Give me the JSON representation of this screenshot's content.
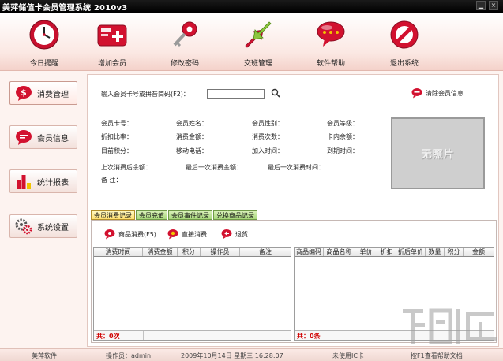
{
  "window": {
    "title": "美萍储值卡会员管理系统 2010v3"
  },
  "title_controls": {
    "close": "×"
  },
  "toolbar": [
    {
      "label": "今日提醒",
      "icon": "clock-icon"
    },
    {
      "label": "增加会员",
      "icon": "add-member-icon"
    },
    {
      "label": "修改密码",
      "icon": "key-icon"
    },
    {
      "label": "交班管理",
      "icon": "exchange-arrows-icon"
    },
    {
      "label": "软件帮助",
      "icon": "help-bubble-icon"
    },
    {
      "label": "退出系统",
      "icon": "no-entry-icon"
    }
  ],
  "sidebar": [
    {
      "label": "消费管理",
      "icon": "dollar-icon",
      "active": true
    },
    {
      "label": "会员信息",
      "icon": "chat-bubble-icon",
      "active": false
    },
    {
      "label": "统计报表",
      "icon": "bar-chart-icon",
      "active": false
    },
    {
      "label": "系统设置",
      "icon": "gears-icon",
      "active": false
    }
  ],
  "search": {
    "label": "输入会员卡号或拼音简码(F2)：",
    "value": ""
  },
  "clear_button": "清除会员信息",
  "fields": {
    "card_no": "会员卡号：",
    "name": "会员姓名：",
    "gender": "会员性别：",
    "level": "会员等级：",
    "discount": "折扣比率：",
    "spent": "消费金额：",
    "times": "消费次数：",
    "balance": "卡内余额：",
    "points": "目前积分：",
    "mobile": "移动电话：",
    "join_date": "加入时间：",
    "expire": "到期时间：",
    "last_balance": "上次消费后余额：",
    "last_amount": "最后一次消费金额：",
    "last_time": "最后一次消费时间：",
    "note": "备    注："
  },
  "photo_text": "无照片",
  "tabs": [
    {
      "label": "会员消费记录",
      "active": true
    },
    {
      "label": "会员充值",
      "active": false
    },
    {
      "label": "会员事件记录",
      "active": false
    },
    {
      "label": "兑换商品记录",
      "active": false
    }
  ],
  "actions": [
    {
      "label": "商品消费(F5)",
      "icon": "cart-bubble-icon"
    },
    {
      "label": "直接消费",
      "icon": "coin-bubble-icon"
    },
    {
      "label": "退货",
      "icon": "return-bubble-icon"
    }
  ],
  "left_table": {
    "columns": [
      "消费时间",
      "消费金额",
      "积分",
      "操作员",
      "备注"
    ],
    "footer": "共：0次"
  },
  "right_table": {
    "columns": [
      "商品编码",
      "商品名称",
      "单价",
      "折扣",
      "折后单价",
      "数量",
      "积分",
      "金额"
    ],
    "footer": "共：0条"
  },
  "statusbar": {
    "company": "美萍软件",
    "operator": "操作员：admin",
    "datetime": "2009年10月14日  星期三  16:28:07",
    "ic_card": "未使用IC卡",
    "help": "按F1查看帮助文档"
  },
  "watermark": "下载吧"
}
